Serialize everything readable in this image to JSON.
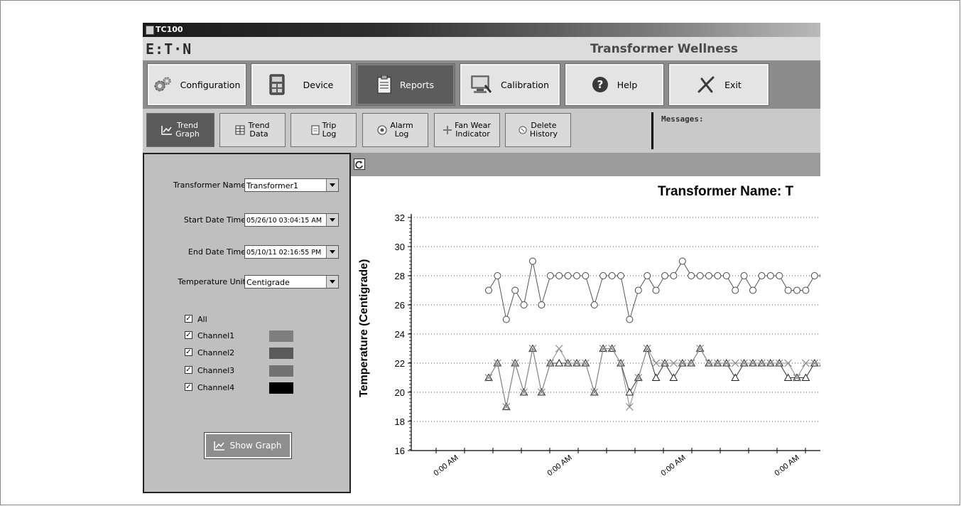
{
  "window": {
    "title": "TC100"
  },
  "brand": {
    "logo": "E:T·N",
    "app_title": "Transformer Wellness"
  },
  "main_nav": [
    {
      "label": "Configuration",
      "icon": "gears-icon",
      "active": false
    },
    {
      "label": "Device",
      "icon": "device-icon",
      "active": false
    },
    {
      "label": "Reports",
      "icon": "clipboard-icon",
      "active": true
    },
    {
      "label": "Calibration",
      "icon": "computer-icon",
      "active": false
    },
    {
      "label": "Help",
      "icon": "help-icon",
      "active": false
    },
    {
      "label": "Exit",
      "icon": "exit-x-icon",
      "active": false
    }
  ],
  "sub_nav": [
    {
      "line1": "Trend",
      "line2": "Graph",
      "icon": "trend-graph-icon",
      "active": true
    },
    {
      "line1": "Trend",
      "line2": "Data",
      "icon": "table-icon",
      "active": false
    },
    {
      "line1": "Trip",
      "line2": "Log",
      "icon": "page-icon",
      "active": false
    },
    {
      "line1": "Alarm",
      "line2": "Log",
      "icon": "alarm-icon",
      "active": false
    },
    {
      "line1": "Fan Wear",
      "line2": "Indicator",
      "icon": "fan-icon",
      "active": false
    },
    {
      "line1": "Delete",
      "line2": "History",
      "icon": "delete-icon",
      "active": false
    }
  ],
  "messages": {
    "label": "Messages:"
  },
  "form": {
    "transformer_name": {
      "label": "Transformer Name",
      "value": "Transformer1"
    },
    "start_date": {
      "label": "Start Date Time",
      "value": "05/26/10 03:04:15 AM"
    },
    "end_date": {
      "label": "End Date Time",
      "value": "05/10/11 02:16:55 PM"
    },
    "temperature_unit": {
      "label": "Temperature Unit",
      "value": "Centigrade"
    }
  },
  "channels": [
    {
      "label": "All",
      "checked": true
    },
    {
      "label": "Channel1",
      "checked": true,
      "color": "#7f7f7f"
    },
    {
      "label": "Channel2",
      "checked": true,
      "color": "#5a5a5a"
    },
    {
      "label": "Channel3",
      "checked": true,
      "color": "#727272"
    },
    {
      "label": "Channel4",
      "checked": true,
      "color": "#000000"
    }
  ],
  "show_graph": {
    "label": "Show Graph"
  },
  "chart_data": {
    "type": "line",
    "title": "Transformer Name: T",
    "ylabel": "Temperature (Centigrade)",
    "ylim": [
      16,
      32
    ],
    "yticks": [
      16,
      18,
      20,
      22,
      24,
      26,
      28,
      30,
      32
    ],
    "grid": true,
    "xtick_labels": [
      "0:00 AM",
      "0:00 AM",
      "0:00 AM",
      "0:00 AM"
    ],
    "series": [
      {
        "marker": "circle",
        "color": "#555555",
        "values": [
          27,
          28,
          25,
          27,
          26,
          29,
          26,
          28,
          28,
          28,
          28,
          28,
          26,
          28,
          28,
          28,
          25,
          27,
          28,
          27,
          28,
          28,
          29,
          28,
          28,
          28,
          28,
          28,
          27,
          28,
          27,
          28,
          28,
          28,
          27,
          27,
          27,
          28,
          28
        ]
      },
      {
        "marker": "triangle",
        "color": "#333333",
        "values": [
          21,
          22,
          19,
          22,
          20,
          23,
          20,
          22,
          22,
          22,
          22,
          22,
          20,
          23,
          23,
          22,
          20,
          21,
          23,
          21,
          22,
          21,
          22,
          22,
          23,
          22,
          22,
          22,
          21,
          22,
          22,
          22,
          22,
          22,
          21,
          21,
          21,
          22,
          22
        ]
      },
      {
        "marker": "x",
        "color": "#8a8a8a",
        "values": [
          21,
          22,
          19,
          22,
          20,
          23,
          20,
          22,
          23,
          22,
          22,
          22,
          20,
          23,
          23,
          22,
          19,
          21,
          23,
          22,
          22,
          22,
          22,
          22,
          23,
          22,
          22,
          22,
          22,
          22,
          22,
          22,
          22,
          22,
          22,
          21,
          22,
          22,
          22
        ]
      }
    ]
  }
}
